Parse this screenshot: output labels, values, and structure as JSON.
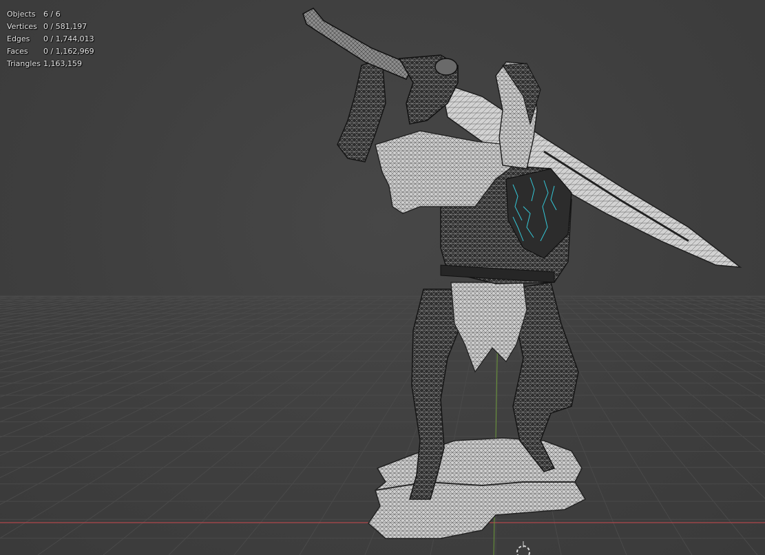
{
  "stats": {
    "objects": {
      "label": "Objects",
      "value": "6 / 6"
    },
    "vertices": {
      "label": "Vertices",
      "value": "0 / 581,197"
    },
    "edges": {
      "label": "Edges",
      "value": "0 / 1,744,013"
    },
    "faces": {
      "label": "Faces",
      "value": "0 / 1,162,969"
    },
    "triangles": {
      "label": "Triangles",
      "value": "1,163,159"
    }
  },
  "colors": {
    "background": "#3d3d3d",
    "grid_line": "#4a4a4a",
    "x_axis": "#b0474b",
    "y_axis": "#6c9a3a",
    "mesh_dark": "#2e2e2e",
    "mesh_light": "#bdbdbd",
    "highlight": "#34c8d8",
    "cursor": "#d8d8d8"
  },
  "scene": {
    "model": "armored-knight-statue-with-greatsword",
    "view_mode": "wireframe-overlay"
  }
}
